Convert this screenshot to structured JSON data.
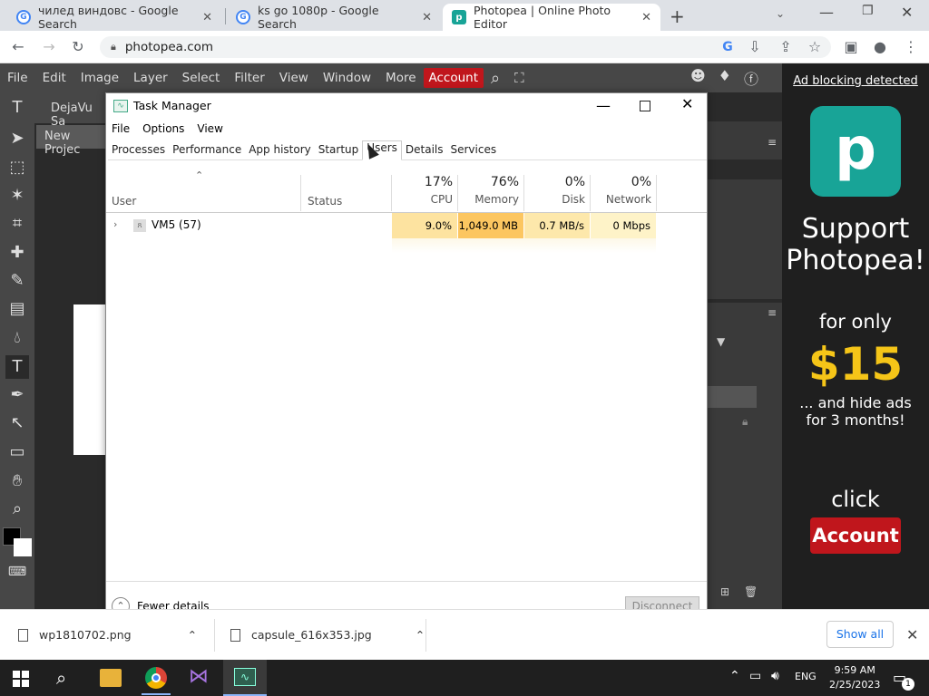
{
  "browser": {
    "tabs": [
      {
        "title": "чилед виндовс - Google Search",
        "favicon": "google-icon"
      },
      {
        "title": "ks go 1080p - Google Search",
        "favicon": "google-icon"
      },
      {
        "title": "Photopea | Online Photo Editor",
        "favicon": "photopea-icon"
      }
    ],
    "url": "photopea.com"
  },
  "photopea": {
    "menu": [
      "File",
      "Edit",
      "Image",
      "Layer",
      "Select",
      "Filter",
      "View",
      "Window",
      "More"
    ],
    "account_label": "Account",
    "font_name": "DejaVu Sa",
    "doc_tab": "New Projec",
    "ad": {
      "blocking_label": "Ad blocking detected",
      "line1": "Support",
      "line2": "Photopea!",
      "line3": "for only",
      "price": "$15",
      "line4": "... and hide ads",
      "line5": "for 3 months!",
      "line6": "click",
      "button": "Account",
      "price_color": "#f5c518",
      "button_color": "#c0161c"
    }
  },
  "task_manager": {
    "title": "Task Manager",
    "menu": [
      "File",
      "Options",
      "View"
    ],
    "tabs": [
      "Processes",
      "Performance",
      "App history",
      "Startup",
      "Users",
      "Details",
      "Services"
    ],
    "active_tab": "Users",
    "columns": {
      "user": "User",
      "status": "Status",
      "cpu": {
        "pct": "17%",
        "label": "CPU"
      },
      "memory": {
        "pct": "76%",
        "label": "Memory"
      },
      "disk": {
        "pct": "0%",
        "label": "Disk"
      },
      "network": {
        "pct": "0%",
        "label": "Network"
      }
    },
    "rows": [
      {
        "user": "VM5 (57)",
        "status": "",
        "cpu": "9.0%",
        "memory": "1,049.0 MB",
        "disk": "0.7 MB/s",
        "network": "0 Mbps"
      }
    ],
    "fewer_details": "Fewer details",
    "disconnect": "Disconnect"
  },
  "downloads": {
    "items": [
      "wp1810702.png",
      "capsule_616x353.jpg"
    ],
    "show_all": "Show all"
  },
  "taskbar": {
    "time": "9:59 AM",
    "date": "2/25/2023",
    "lang": "ENG",
    "notif_count": "1"
  }
}
